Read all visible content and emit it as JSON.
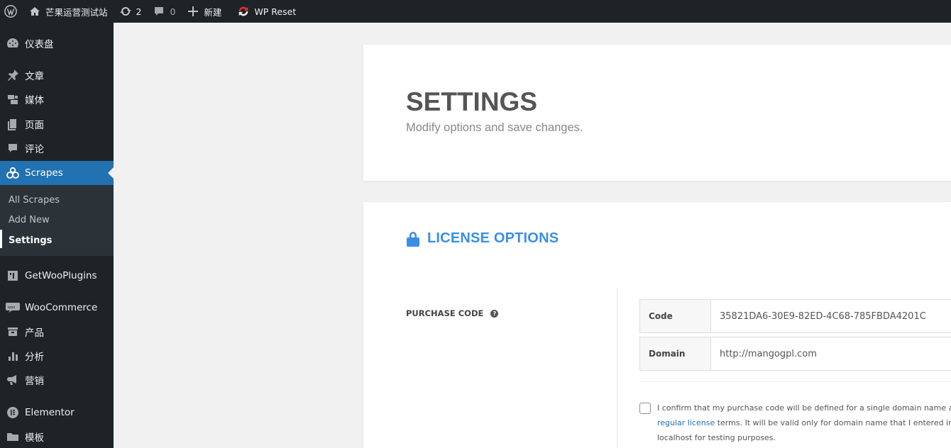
{
  "admin_bar": {
    "site_name": "芒果运营测试站",
    "updates_count": "2",
    "comments_count": "0",
    "new_label": "新建",
    "wp_reset_label": "WP Reset"
  },
  "sidebar": {
    "items": [
      {
        "label": "仪表盘",
        "icon": "dashboard-icon"
      },
      {
        "label": "文章",
        "icon": "pin-icon"
      },
      {
        "label": "媒体",
        "icon": "media-icon"
      },
      {
        "label": "页面",
        "icon": "page-icon"
      },
      {
        "label": "评论",
        "icon": "comment-icon"
      },
      {
        "label": "Scrapes",
        "icon": "scrapes-icon"
      },
      {
        "label": "GetWooPlugins",
        "icon": "plugins-icon"
      },
      {
        "label": "WooCommerce",
        "icon": "woo-icon"
      },
      {
        "label": "产品",
        "icon": "products-icon"
      },
      {
        "label": "分析",
        "icon": "analytics-icon"
      },
      {
        "label": "营销",
        "icon": "marketing-icon"
      },
      {
        "label": "Elementor",
        "icon": "elementor-icon"
      },
      {
        "label": "模板",
        "icon": "templates-icon"
      }
    ],
    "submenu": [
      "All Scrapes",
      "Add New",
      "Settings"
    ]
  },
  "page": {
    "title": "SETTINGS",
    "subtitle": "Modify options and save changes."
  },
  "license": {
    "section_title": "LICENSE OPTIONS",
    "purchase_code_label": "PURCHASE CODE",
    "help_glyph": "?",
    "code_label": "Code",
    "code_value": "35821DA6-30E9-82ED-4C68-785FBDA4201C",
    "domain_label": "Domain",
    "domain_value": "http://mangogpl.com",
    "confirm_line1": "I confirm that my purchase code will be defined for a single domain name at fi",
    "confirm_link": "regular license",
    "confirm_line2_rest": " terms. It will be valid only for domain name that I entered inclu",
    "confirm_line3": "localhost for testing purposes."
  },
  "colors": {
    "accent": "#2271b1",
    "section_title": "#3a8ee6",
    "sidebar_bg": "#1d2327"
  }
}
